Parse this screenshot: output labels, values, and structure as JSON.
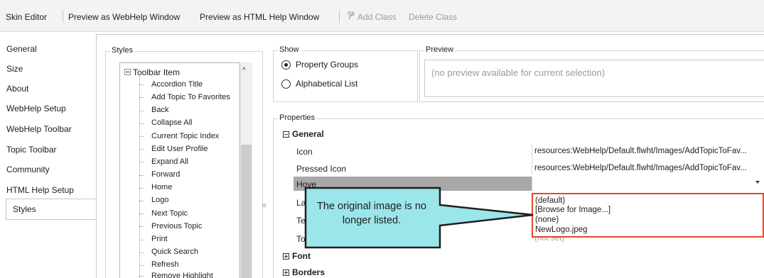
{
  "toolbar": {
    "skin_editor": "Skin Editor",
    "preview_webhelp": "Preview as WebHelp Window",
    "preview_htmlhelp": "Preview as HTML Help Window",
    "add_class": "Add Class",
    "delete_class": "Delete Class",
    "add_class_icon": "brush-icon"
  },
  "nav": {
    "items": [
      "General",
      "Size",
      "About",
      "WebHelp Setup",
      "WebHelp Toolbar",
      "Topic Toolbar",
      "Community",
      "HTML Help Setup",
      "Styles"
    ],
    "selected": "Styles"
  },
  "styles_panel": {
    "legend": "Styles",
    "root": "Toolbar Item",
    "children": [
      "Accordion Title",
      "Add Topic To Favorites",
      "Back",
      "Collapse All",
      "Current Topic Index",
      "Edit User Profile",
      "Expand All",
      "Forward",
      "Home",
      "Logo",
      "Next Topic",
      "Previous Topic",
      "Print",
      "Quick Search",
      "Refresh",
      "Remove Highlight"
    ]
  },
  "show": {
    "legend": "Show",
    "option_groups": "Property Groups",
    "option_alpha": "Alphabetical List",
    "selected": "Property Groups"
  },
  "preview": {
    "legend": "Preview",
    "text": "(no preview available for current selection)"
  },
  "properties": {
    "legend": "Properties",
    "category_general": "General",
    "rows": [
      {
        "name": "Icon",
        "value": "resources:WebHelp/Default.flwht/Images/AddTopicToFav..."
      },
      {
        "name": "Pressed Icon",
        "value": "resources:WebHelp/Default.flwht/Images/AddTopicToFav..."
      },
      {
        "name": "Hove",
        "value": ""
      },
      {
        "name": "Labe",
        "value": ""
      },
      {
        "name": "Text",
        "value": ""
      },
      {
        "name": "Tool",
        "value": "(not set)"
      }
    ],
    "category_font": "Font",
    "category_borders": "Borders"
  },
  "dropdown": {
    "options": [
      "(default)",
      "[Browse for Image...]",
      "(none)",
      "NewLogo.jpeg"
    ]
  },
  "callout": {
    "text": "The original image is no longer listed."
  },
  "colors": {
    "highlight_border": "#e04a2a",
    "callout_fill": "#9be6ea",
    "hover_row": "#a8a8a8"
  }
}
